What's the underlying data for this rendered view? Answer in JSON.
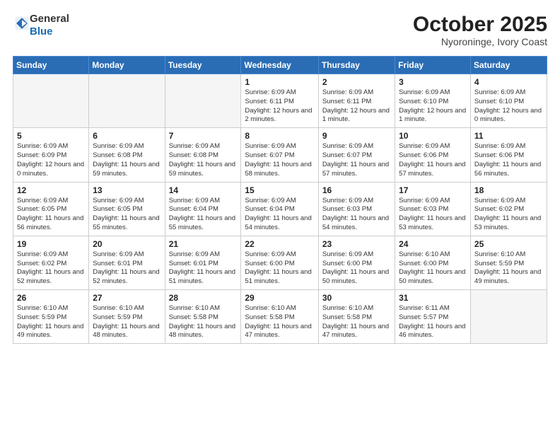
{
  "header": {
    "logo_general": "General",
    "logo_blue": "Blue",
    "month": "October 2025",
    "location": "Nyoroninge, Ivory Coast"
  },
  "weekdays": [
    "Sunday",
    "Monday",
    "Tuesday",
    "Wednesday",
    "Thursday",
    "Friday",
    "Saturday"
  ],
  "weeks": [
    [
      {
        "day": "",
        "info": ""
      },
      {
        "day": "",
        "info": ""
      },
      {
        "day": "",
        "info": ""
      },
      {
        "day": "1",
        "info": "Sunrise: 6:09 AM\nSunset: 6:11 PM\nDaylight: 12 hours and 2 minutes."
      },
      {
        "day": "2",
        "info": "Sunrise: 6:09 AM\nSunset: 6:11 PM\nDaylight: 12 hours and 1 minute."
      },
      {
        "day": "3",
        "info": "Sunrise: 6:09 AM\nSunset: 6:10 PM\nDaylight: 12 hours and 1 minute."
      },
      {
        "day": "4",
        "info": "Sunrise: 6:09 AM\nSunset: 6:10 PM\nDaylight: 12 hours and 0 minutes."
      }
    ],
    [
      {
        "day": "5",
        "info": "Sunrise: 6:09 AM\nSunset: 6:09 PM\nDaylight: 12 hours and 0 minutes."
      },
      {
        "day": "6",
        "info": "Sunrise: 6:09 AM\nSunset: 6:08 PM\nDaylight: 11 hours and 59 minutes."
      },
      {
        "day": "7",
        "info": "Sunrise: 6:09 AM\nSunset: 6:08 PM\nDaylight: 11 hours and 59 minutes."
      },
      {
        "day": "8",
        "info": "Sunrise: 6:09 AM\nSunset: 6:07 PM\nDaylight: 11 hours and 58 minutes."
      },
      {
        "day": "9",
        "info": "Sunrise: 6:09 AM\nSunset: 6:07 PM\nDaylight: 11 hours and 57 minutes."
      },
      {
        "day": "10",
        "info": "Sunrise: 6:09 AM\nSunset: 6:06 PM\nDaylight: 11 hours and 57 minutes."
      },
      {
        "day": "11",
        "info": "Sunrise: 6:09 AM\nSunset: 6:06 PM\nDaylight: 11 hours and 56 minutes."
      }
    ],
    [
      {
        "day": "12",
        "info": "Sunrise: 6:09 AM\nSunset: 6:05 PM\nDaylight: 11 hours and 56 minutes."
      },
      {
        "day": "13",
        "info": "Sunrise: 6:09 AM\nSunset: 6:05 PM\nDaylight: 11 hours and 55 minutes."
      },
      {
        "day": "14",
        "info": "Sunrise: 6:09 AM\nSunset: 6:04 PM\nDaylight: 11 hours and 55 minutes."
      },
      {
        "day": "15",
        "info": "Sunrise: 6:09 AM\nSunset: 6:04 PM\nDaylight: 11 hours and 54 minutes."
      },
      {
        "day": "16",
        "info": "Sunrise: 6:09 AM\nSunset: 6:03 PM\nDaylight: 11 hours and 54 minutes."
      },
      {
        "day": "17",
        "info": "Sunrise: 6:09 AM\nSunset: 6:03 PM\nDaylight: 11 hours and 53 minutes."
      },
      {
        "day": "18",
        "info": "Sunrise: 6:09 AM\nSunset: 6:02 PM\nDaylight: 11 hours and 53 minutes."
      }
    ],
    [
      {
        "day": "19",
        "info": "Sunrise: 6:09 AM\nSunset: 6:02 PM\nDaylight: 11 hours and 52 minutes."
      },
      {
        "day": "20",
        "info": "Sunrise: 6:09 AM\nSunset: 6:01 PM\nDaylight: 11 hours and 52 minutes."
      },
      {
        "day": "21",
        "info": "Sunrise: 6:09 AM\nSunset: 6:01 PM\nDaylight: 11 hours and 51 minutes."
      },
      {
        "day": "22",
        "info": "Sunrise: 6:09 AM\nSunset: 6:00 PM\nDaylight: 11 hours and 51 minutes."
      },
      {
        "day": "23",
        "info": "Sunrise: 6:09 AM\nSunset: 6:00 PM\nDaylight: 11 hours and 50 minutes."
      },
      {
        "day": "24",
        "info": "Sunrise: 6:10 AM\nSunset: 6:00 PM\nDaylight: 11 hours and 50 minutes."
      },
      {
        "day": "25",
        "info": "Sunrise: 6:10 AM\nSunset: 5:59 PM\nDaylight: 11 hours and 49 minutes."
      }
    ],
    [
      {
        "day": "26",
        "info": "Sunrise: 6:10 AM\nSunset: 5:59 PM\nDaylight: 11 hours and 49 minutes."
      },
      {
        "day": "27",
        "info": "Sunrise: 6:10 AM\nSunset: 5:59 PM\nDaylight: 11 hours and 48 minutes."
      },
      {
        "day": "28",
        "info": "Sunrise: 6:10 AM\nSunset: 5:58 PM\nDaylight: 11 hours and 48 minutes."
      },
      {
        "day": "29",
        "info": "Sunrise: 6:10 AM\nSunset: 5:58 PM\nDaylight: 11 hours and 47 minutes."
      },
      {
        "day": "30",
        "info": "Sunrise: 6:10 AM\nSunset: 5:58 PM\nDaylight: 11 hours and 47 minutes."
      },
      {
        "day": "31",
        "info": "Sunrise: 6:11 AM\nSunset: 5:57 PM\nDaylight: 11 hours and 46 minutes."
      },
      {
        "day": "",
        "info": ""
      }
    ]
  ]
}
